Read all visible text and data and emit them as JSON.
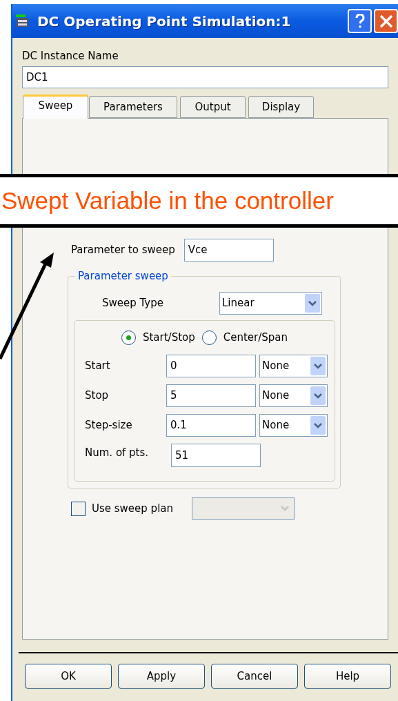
{
  "window": {
    "title": "DC Operating Point Simulation:1"
  },
  "instance_name": {
    "label": "DC Instance Name",
    "value": "DC1"
  },
  "tabs": [
    {
      "label": "Sweep",
      "selected": true
    },
    {
      "label": "Parameters",
      "selected": false
    },
    {
      "label": "Output",
      "selected": false
    },
    {
      "label": "Display",
      "selected": false
    }
  ],
  "sweep": {
    "parameter_label": "Parameter to sweep",
    "parameter_value": "Vce",
    "group_title": "Parameter sweep",
    "sweep_type_label": "Sweep Type",
    "sweep_type_value": "Linear",
    "modes": [
      {
        "label": "Start/Stop",
        "selected": true
      },
      {
        "label": "Center/Span",
        "selected": false
      }
    ],
    "fields": [
      {
        "label": "Start",
        "value": "0",
        "unit": "None"
      },
      {
        "label": "Stop",
        "value": "5",
        "unit": "None"
      },
      {
        "label": "Step-size",
        "value": "0.1",
        "unit": "None"
      },
      {
        "label": "Num. of pts.",
        "value": "51"
      }
    ],
    "sweep_plan": {
      "label": "Use sweep plan",
      "checked": false,
      "disabled": true
    }
  },
  "buttons": [
    "OK",
    "Apply",
    "Cancel",
    "Help"
  ],
  "callout": {
    "text": "Swept Variable in the controller"
  }
}
